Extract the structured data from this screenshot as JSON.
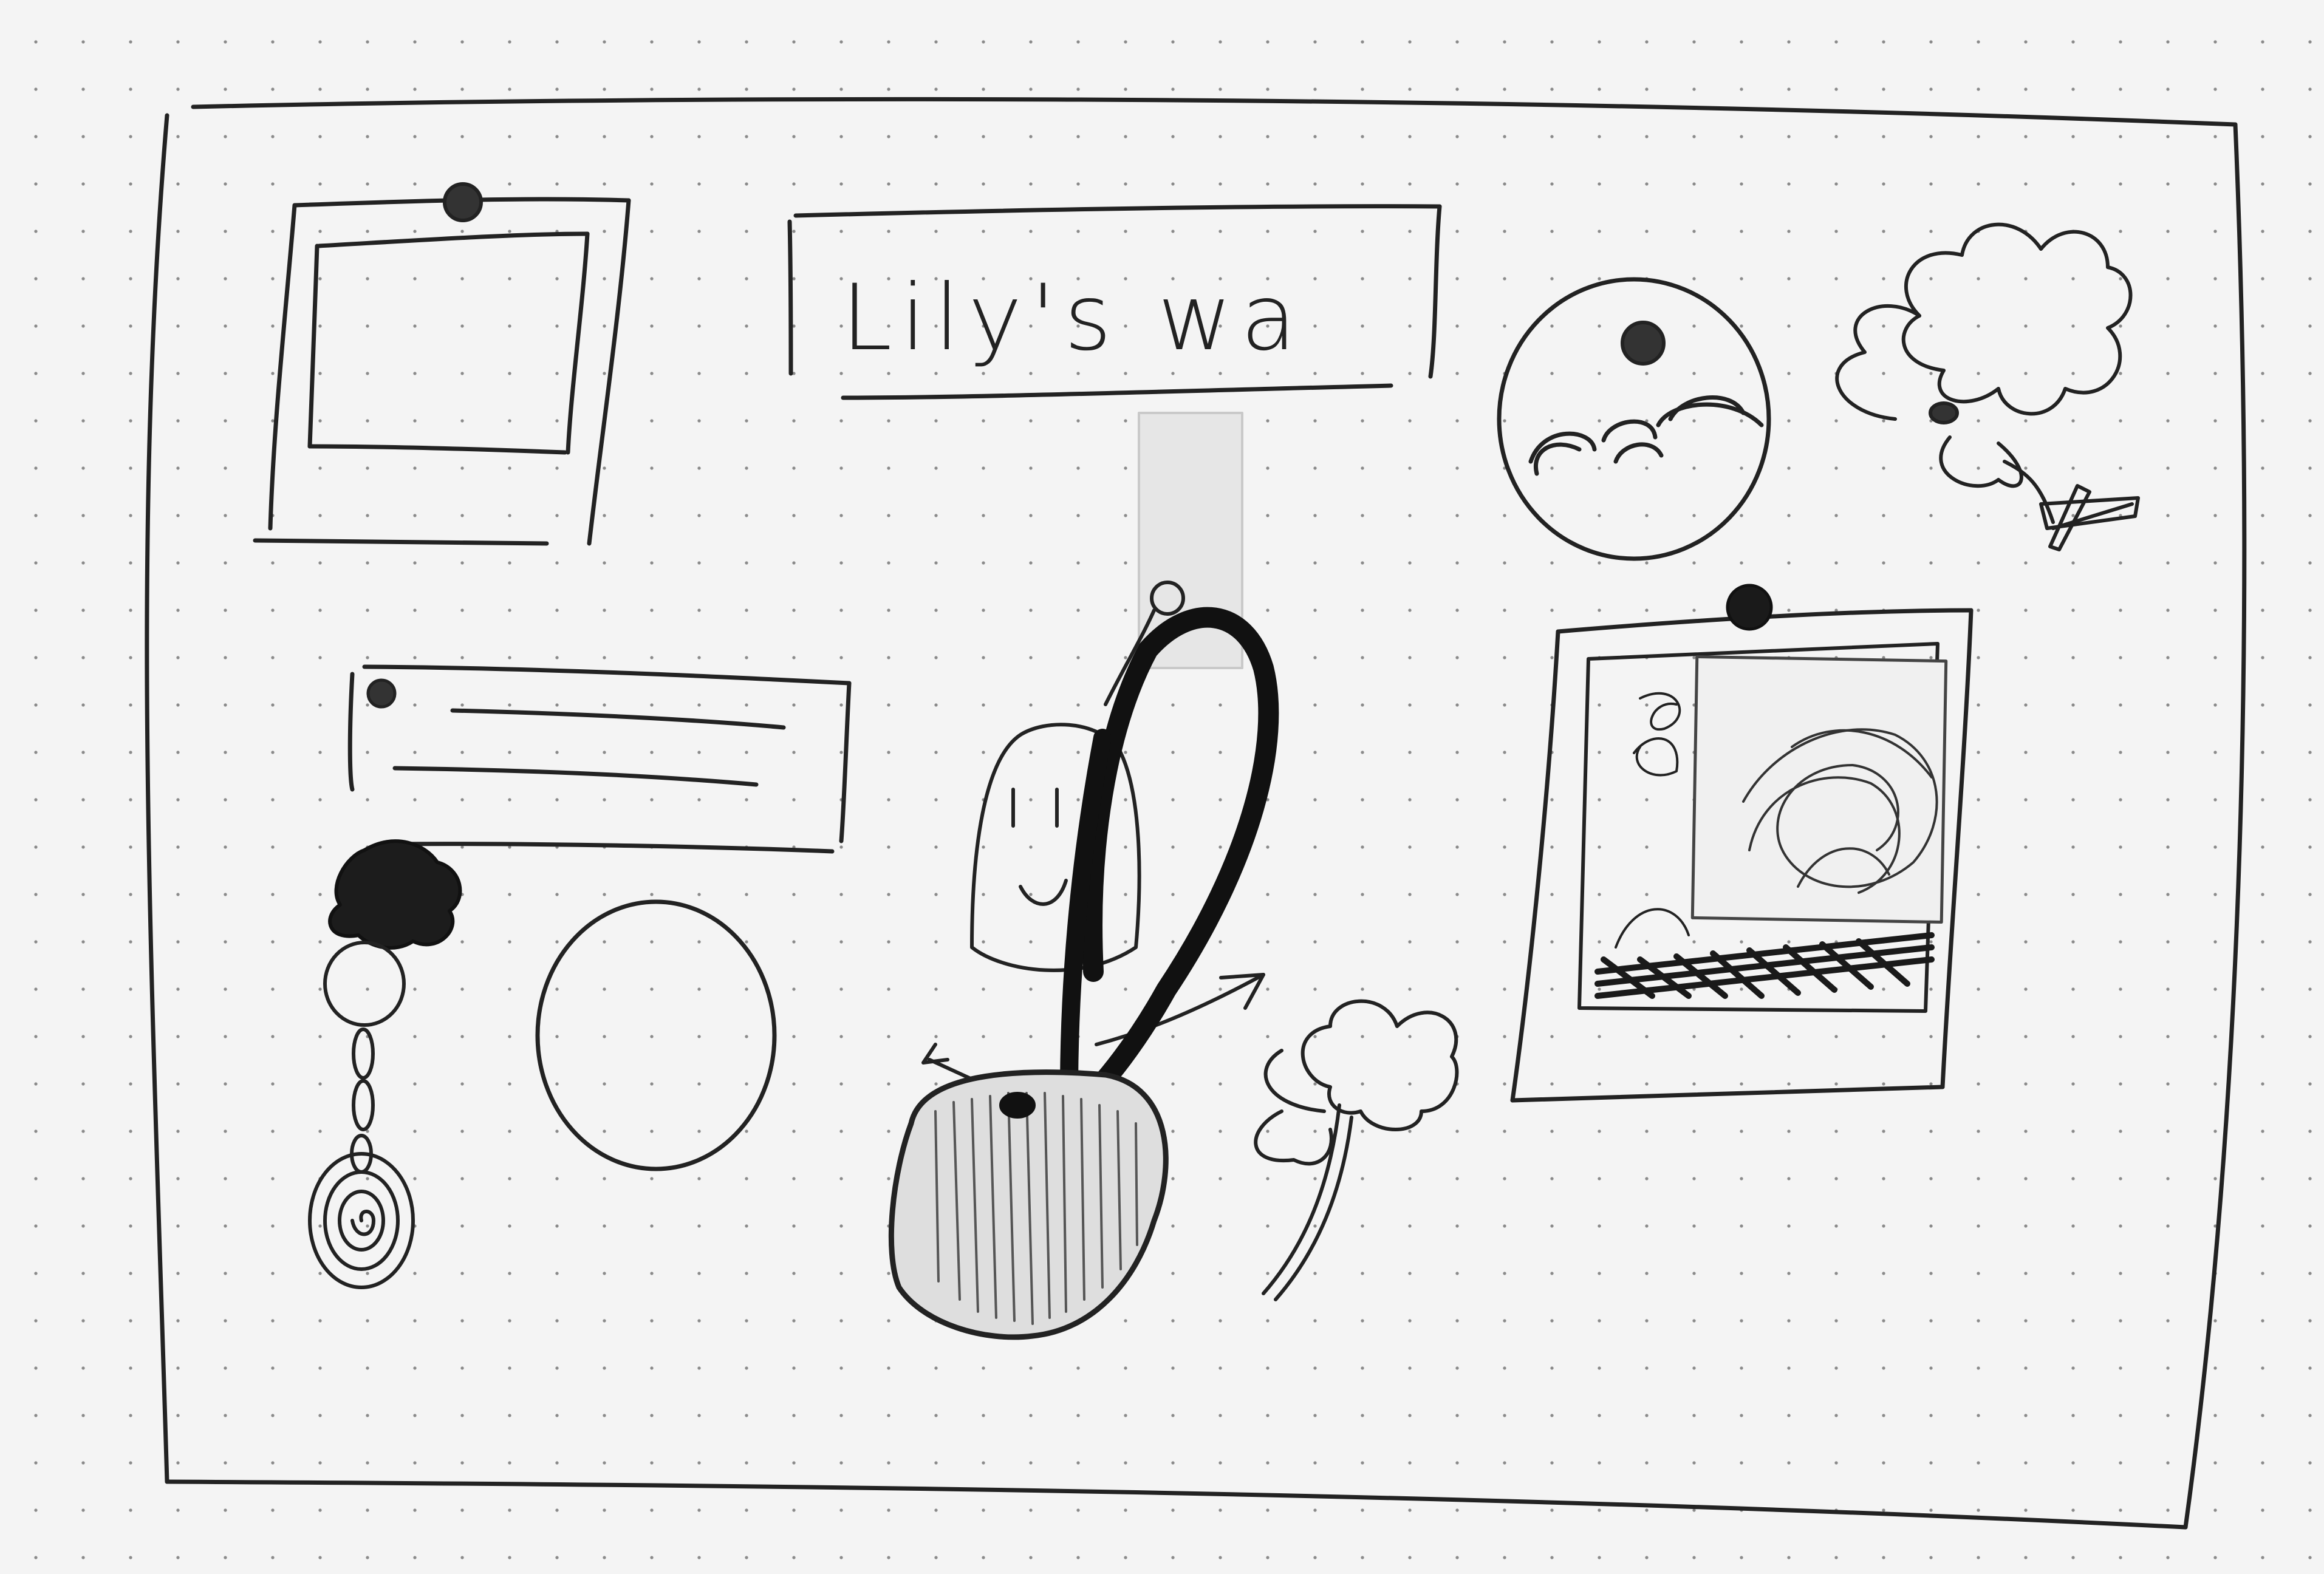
{
  "sketch": {
    "title_banner": {
      "text": "Lily's wa"
    },
    "ink_color": "#222222",
    "paper_color": "#f4f4f4",
    "icons": {
      "pinned_frame": "pinned-photo-frame-icon",
      "note_card": "pinned-note-card-icon",
      "keychain": "yarn-keychain-icon",
      "circle": "empty-circle-icon",
      "pendant": "rope-pendant-icon",
      "clouds": "cloud-circle-icon",
      "flowers": "flower-doodle-icon",
      "photo_stack": "pinned-photo-stack-icon"
    }
  }
}
